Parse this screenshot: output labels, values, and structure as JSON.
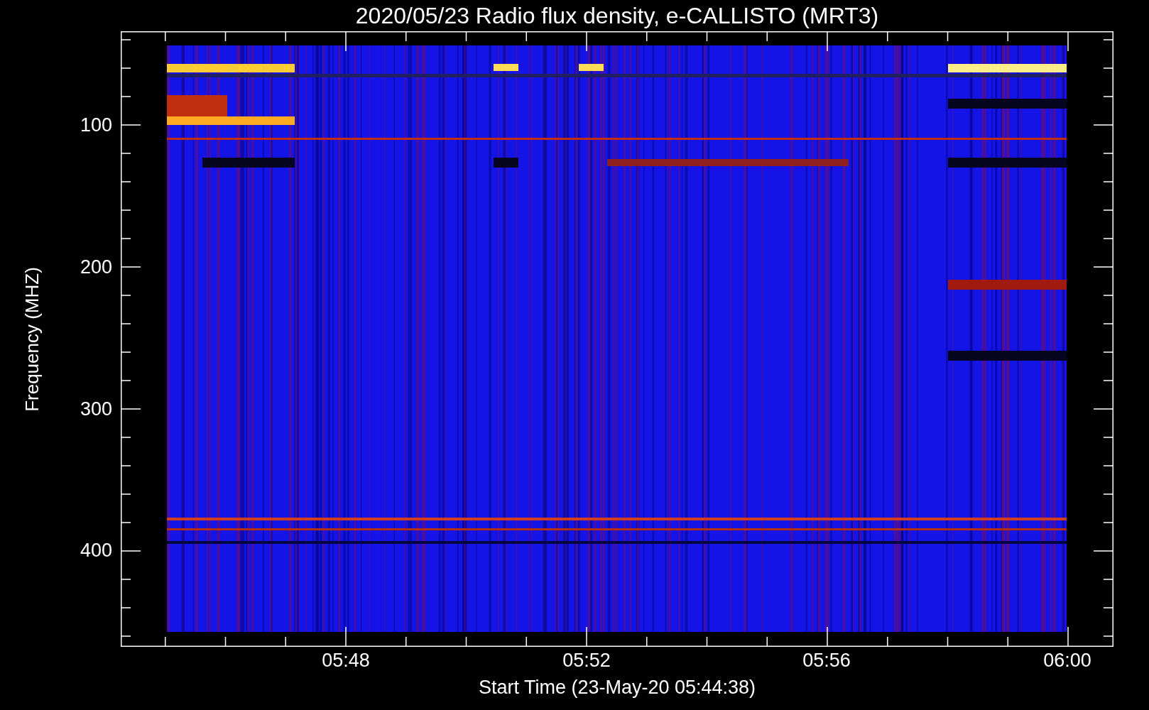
{
  "title": "2020/05/23  Radio flux density, e-CALLISTO (MRT3)",
  "plot": {
    "ylabel": "Frequency (MHZ)",
    "xlabel": "Start Time (23-May-20 05:44:38)",
    "yticks": [
      "100",
      "200",
      "300",
      "400"
    ],
    "xticks": [
      "05:48",
      "05:52",
      "05:56",
      "06:00"
    ]
  }
}
